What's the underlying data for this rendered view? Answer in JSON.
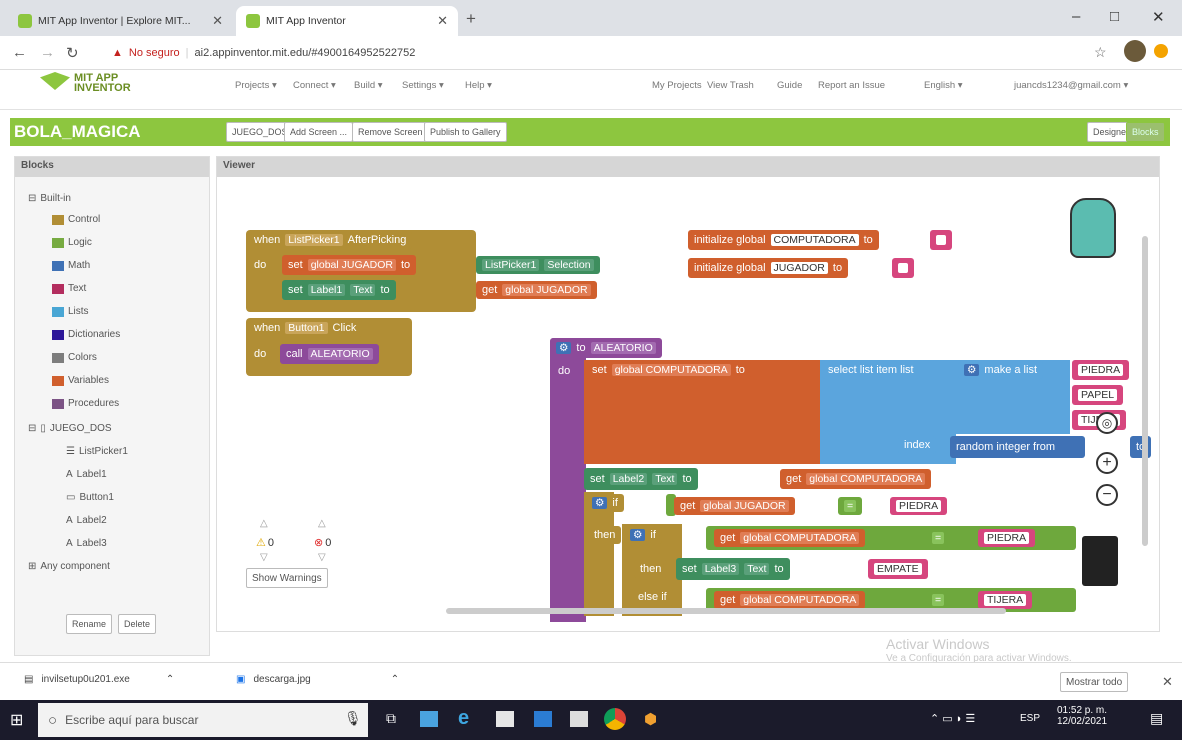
{
  "browser": {
    "tabs": [
      {
        "title": "MIT App Inventor | Explore MIT..."
      },
      {
        "title": "MIT App Inventor"
      }
    ],
    "new_tab": "+",
    "warning": "No seguro",
    "url": "ai2.appinventor.mit.edu/#4900164952522752",
    "window_controls": [
      "–",
      "□",
      "✕"
    ]
  },
  "app": {
    "logo": "MIT APP INVENTOR",
    "menu": [
      "Projects ▾",
      "Connect ▾",
      "Build ▾",
      "Settings ▾",
      "Help ▾"
    ],
    "right_menu": [
      "My Projects",
      "View Trash",
      "Guide",
      "Report an Issue",
      "English ▾",
      "juancds1234@gmail.com ▾"
    ],
    "project_name": "BOLA_MAGICA",
    "screen_select": "JUEGO_DOS ▾",
    "buttons": [
      "Add Screen ...",
      "Remove Screen",
      "Publish to Gallery"
    ],
    "designer": "Designer",
    "blocks_btn": "Blocks"
  },
  "blocks_panel": {
    "header": "Blocks",
    "builtin": "Built-in",
    "items": [
      {
        "label": "Control",
        "color": "#b18e35"
      },
      {
        "label": "Logic",
        "color": "#77ab41"
      },
      {
        "label": "Math",
        "color": "#3f71b5"
      },
      {
        "label": "Text",
        "color": "#b32d5e"
      },
      {
        "label": "Lists",
        "color": "#49a6d4"
      },
      {
        "label": "Dictionaries",
        "color": "#2d1799"
      },
      {
        "label": "Colors",
        "color": "#7d7d7d"
      },
      {
        "label": "Variables",
        "color": "#d05f2d"
      },
      {
        "label": "Procedures",
        "color": "#7c5385"
      }
    ],
    "screen": "JUEGO_DOS",
    "components": [
      "ListPicker1",
      "Label1",
      "Button1",
      "Label2",
      "Label3"
    ],
    "any": "Any component",
    "rename": "Rename",
    "delete": "Delete"
  },
  "viewer": {
    "header": "Viewer",
    "warn_count": "0",
    "err_count": "0",
    "show_warnings": "Show Warnings",
    "blocks": {
      "when": "when",
      "listpicker": "ListPicker1",
      "afterpicking": "AfterPicking",
      "do": "do",
      "set": "set",
      "global_jugador": "global JUGADOR",
      "to": "to",
      "selection": "Selection",
      "label1": "Label1",
      "text": "Text",
      "get": "get",
      "get_global_jugador": "global JUGADOR",
      "button1": "Button1",
      "click": "Click",
      "call": "call",
      "aleatorio": "ALEATORIO",
      "init1": "initialize global",
      "computadora": "COMPUTADORA",
      "jugador": "JUGADOR",
      "proc_to": "to",
      "global_computadora": "global COMPUTADORA",
      "select_list_item": "select list item  list",
      "make_a_list": "make a list",
      "piedra": "PIEDRA",
      "papel": "PAPEL",
      "tijera": "TIJERA",
      "index": "index",
      "random": "random integer from",
      "label2": "Label2",
      "if": "if",
      "then": "then",
      "eq": "=",
      "label3": "Label3",
      "empate": "EMPATE",
      "elseif": "else if"
    }
  },
  "watermark": {
    "line1": "Activar Windows",
    "line2": "Ve a Configuración para activar Windows."
  },
  "downloads": {
    "files": [
      "invilsetup0u201.exe",
      "descarga.jpg"
    ],
    "show_all": "Mostrar todo"
  },
  "taskbar": {
    "search": "Escribe aquí para buscar",
    "lang": "ESP",
    "time": "01:52 p. m.",
    "date": "12/02/2021"
  }
}
